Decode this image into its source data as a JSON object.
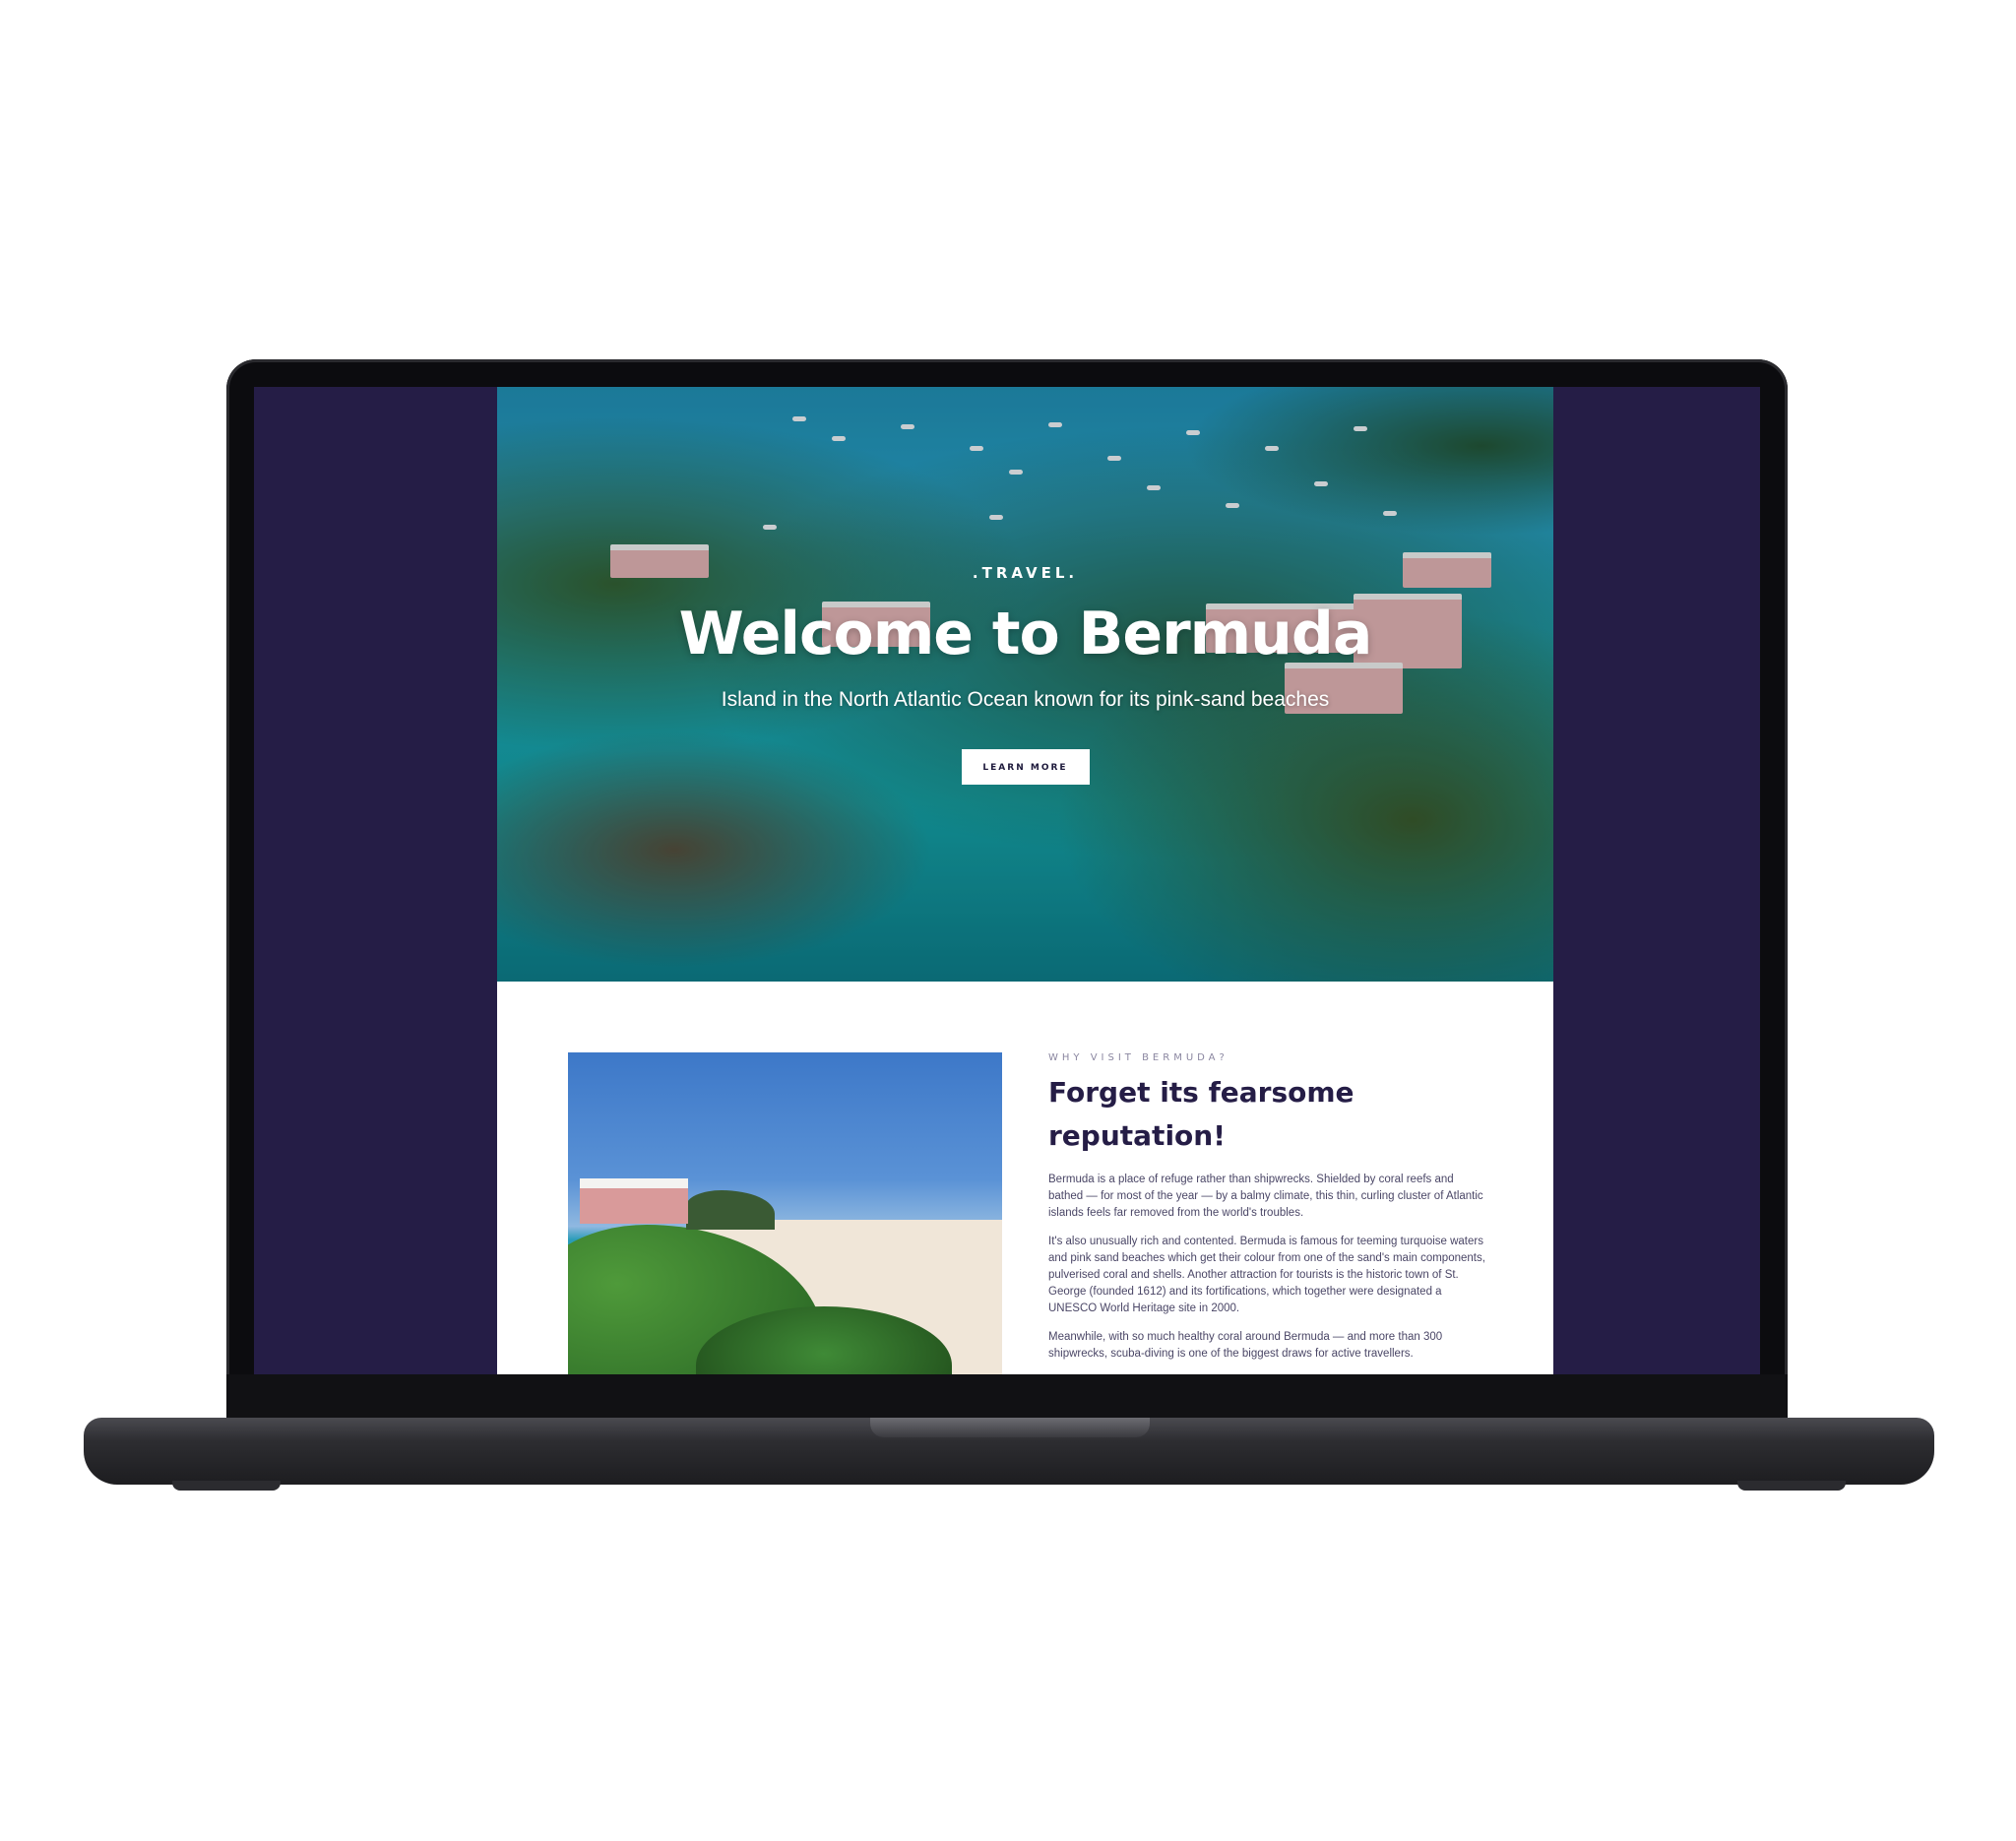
{
  "hero": {
    "kicker": ".TRAVEL.",
    "title": "Welcome to Bermuda",
    "subtitle": "Island in the North Atlantic Ocean known for its pink-sand beaches",
    "button_label": "LEARN MORE"
  },
  "about": {
    "kicker": "WHY VISIT BERMUDA?",
    "heading_line1": "Forget its fearsome",
    "heading_line2": "reputation!",
    "paragraphs": [
      "Bermuda is a place of refuge rather than shipwrecks. Shielded by coral reefs and bathed — for most of the year — by a balmy climate, this thin, curling cluster of Atlantic islands feels far removed from the world's troubles.",
      "It's also unusually rich and contented. Bermuda is famous for teeming turquoise waters and pink sand beaches which get their colour from one of the sand's main components, pulverised coral and shells. Another attraction for tourists is the historic town of St. George (founded 1612) and its fortifications, which together were designated a UNESCO World Heritage site in 2000.",
      "Meanwhile, with so much healthy coral around Bermuda — and more than 300 shipwrecks, scuba-diving is one of the biggest draws for active travellers."
    ]
  },
  "colors": {
    "page_background": "#251d46",
    "heading_color": "#251d46",
    "button_background": "#ffffff"
  }
}
